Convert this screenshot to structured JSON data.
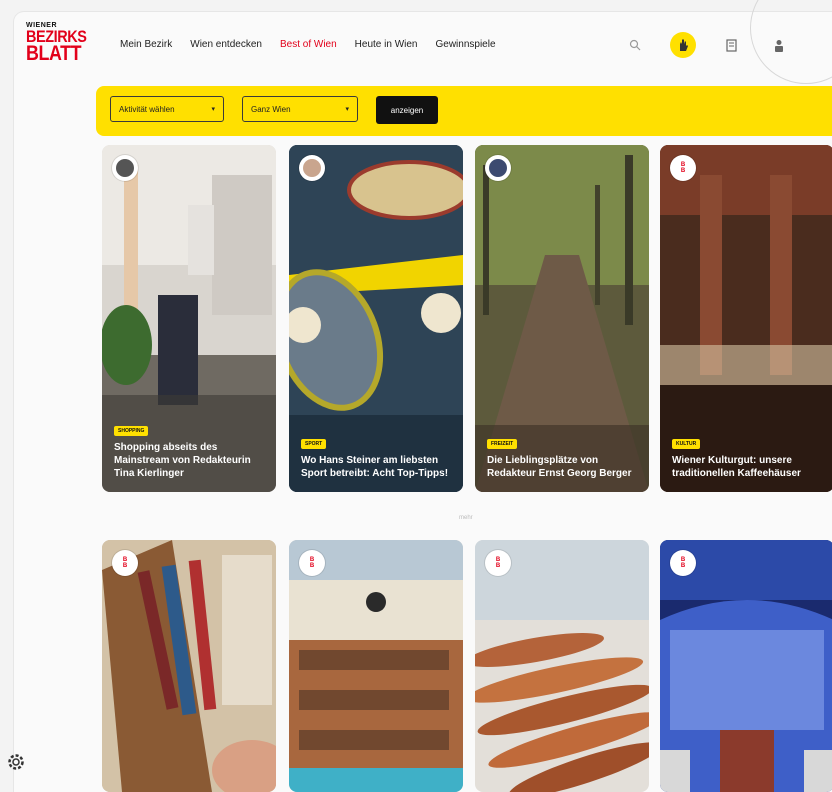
{
  "logo": {
    "small": "WIENER",
    "line1": "BEZIRKS",
    "line2": "BLATT"
  },
  "nav": [
    {
      "label": "Mein Bezirk",
      "active": false
    },
    {
      "label": "Wien entdecken",
      "active": false
    },
    {
      "label": "Best of Wien",
      "active": true
    },
    {
      "label": "Heute in Wien",
      "active": false
    },
    {
      "label": "Gewinnspiele",
      "active": false
    }
  ],
  "header_icons": [
    "search-icon",
    "hand-icon",
    "bookmark-icon",
    "account-icon"
  ],
  "filters": {
    "activity": "Aktivität wählen",
    "area": "Ganz Wien",
    "submit": "anzeigen"
  },
  "cards_row1": [
    {
      "tag": "Shopping",
      "title": "Shopping abseits des Mainstream von Redakteurin Tina Kierlinger"
    },
    {
      "tag": "Sport",
      "title": "Wo Hans Steiner am liebsten Sport betreibt: Acht Top-Tipps!"
    },
    {
      "tag": "Freizeit",
      "title": "Die Lieblingsplätze von Redakteur Ernst Georg Berger"
    },
    {
      "tag": "Kultur",
      "title": "Wiener Kulturgut: unsere traditionellen Kaffeehäuser"
    }
  ],
  "more_label": "mehr",
  "colors": {
    "accent": "#ffe000",
    "brand": "#e2001a"
  }
}
